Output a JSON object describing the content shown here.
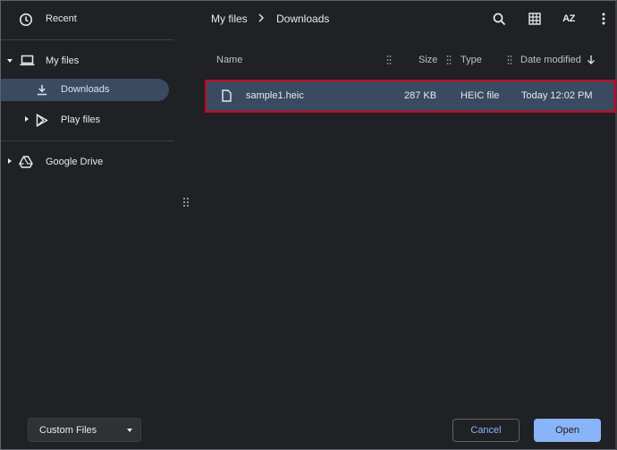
{
  "sidebar": {
    "recent_label": "Recent",
    "my_files_label": "My files",
    "downloads_label": "Downloads",
    "play_files_label": "Play files",
    "google_drive_label": "Google Drive"
  },
  "breadcrumb": {
    "root": "My files",
    "current": "Downloads"
  },
  "toolbar": {
    "sort_label": "AZ"
  },
  "table": {
    "columns": {
      "name": "Name",
      "size": "Size",
      "type": "Type",
      "date": "Date modified"
    },
    "rows": [
      {
        "name": "sample1.heic",
        "size": "287 KB",
        "type": "HEIC file",
        "date": "Today 12:02 PM"
      }
    ]
  },
  "footer": {
    "file_type_select": "Custom Files",
    "cancel_label": "Cancel",
    "open_label": "Open"
  },
  "colors": {
    "background": "#202124",
    "selection": "#3a4a60",
    "highlight_outline": "#d0021b",
    "accent": "#8ab4f8"
  },
  "icons": [
    "clock-icon",
    "laptop-icon",
    "download-icon",
    "play-store-icon",
    "google-drive-icon",
    "search-icon",
    "grid-view-icon",
    "sort-az-icon",
    "more-vert-icon",
    "file-icon",
    "arrow-down-icon",
    "chevron-right-icon"
  ]
}
